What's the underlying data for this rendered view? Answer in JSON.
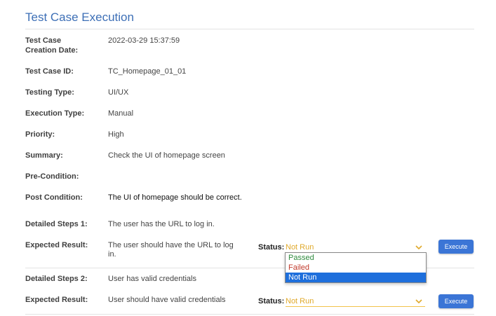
{
  "header": {
    "title": "Test Case Execution"
  },
  "fields": {
    "creation_date_label_1": "Test Case",
    "creation_date_label_2": "Creation Date:",
    "creation_date": "2022-03-29 15:37:59",
    "id_label": "Test Case ID:",
    "id": "TC_Homepage_01_01",
    "testing_type_label": "Testing Type:",
    "testing_type": "UI/UX",
    "execution_type_label": "Execution Type:",
    "execution_type": "Manual",
    "priority_label": "Priority:",
    "priority": "High",
    "summary_label": "Summary:",
    "summary": "Check the UI of homepage screen",
    "precondition_label": "Pre-Condition:",
    "precondition": "",
    "postcondition_label": "Post Condition:",
    "postcondition": "The UI of homepage should be correct."
  },
  "steps": [
    {
      "step_label": "Detailed Steps 1:",
      "step": "The user has the URL to log in.",
      "expected_label": "Expected Result:",
      "expected_line1": "The user should have the URL to log",
      "expected_line2": "in.",
      "status_label": "Status:",
      "status_value": "Not Run",
      "execute_label": "Execute"
    },
    {
      "step_label": "Detailed Steps 2:",
      "step": "User has valid credentials",
      "expected_label": "Expected Result:",
      "expected_line1": "User should have valid credentials",
      "status_label": "Status:",
      "status_value": "Not Run",
      "execute_label": "Execute"
    }
  ],
  "dropdown": {
    "options": [
      "Passed",
      "Failed",
      "Not Run"
    ],
    "selected": "Not Run"
  },
  "colors": {
    "accent": "#3d6fb6",
    "button": "#3b75d6",
    "status_select": "#e0a92b",
    "passed": "#2e8b3e",
    "failed": "#c0392b",
    "option_highlight": "#1e6fdc"
  },
  "icons": {
    "select_caret": "chevron-down-icon"
  }
}
